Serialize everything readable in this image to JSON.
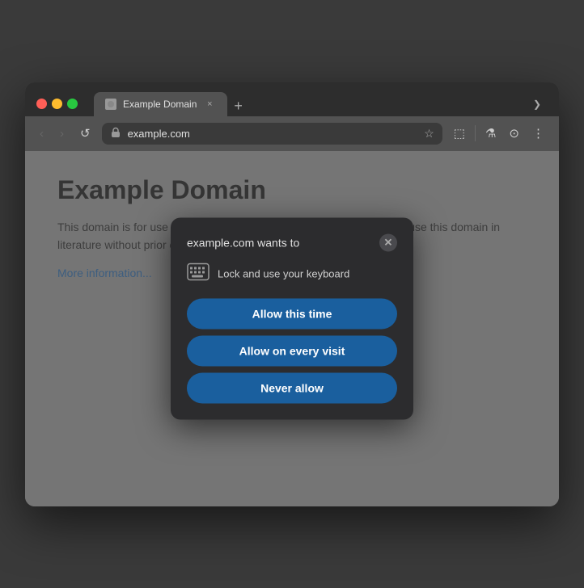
{
  "browser": {
    "tab": {
      "title": "Example Domain",
      "close_label": "×"
    },
    "tab_new_label": "+",
    "tab_chevron_label": "❯",
    "nav": {
      "back_label": "‹",
      "forward_label": "›",
      "reload_label": "↺",
      "address": "example.com",
      "star_label": "☆",
      "extensions_label": "⬚",
      "lab_label": "⚗",
      "profile_label": "⊙",
      "menu_label": "⋮"
    }
  },
  "page": {
    "title": "Example Domain",
    "body": "This domain is for use in illustrative examples in documents. You may use this domain in literature without prior coordination or asking for permission.",
    "link": "More information..."
  },
  "popup": {
    "title": "example.com wants to",
    "close_label": "✕",
    "permission_text": "Lock and use your keyboard",
    "btn_allow_once": "Allow this time",
    "btn_allow_always": "Allow on every visit",
    "btn_never": "Never allow"
  },
  "colors": {
    "btn_primary": "#1a5f9e",
    "popup_bg": "#2c2c2e"
  }
}
